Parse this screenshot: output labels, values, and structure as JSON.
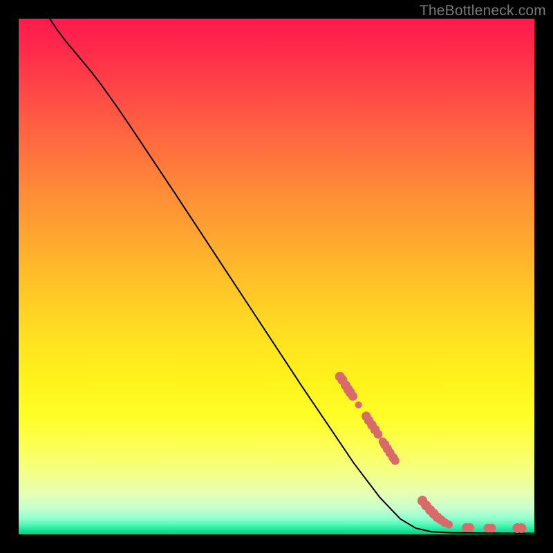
{
  "watermark": "TheBottleneck.com",
  "colors": {
    "frame": "#000000",
    "curve": "#000000",
    "marker_fill": "#d96a6a",
    "marker_stroke": "#a84a4a"
  },
  "chart_data": {
    "type": "line",
    "title": "",
    "xlabel": "",
    "ylabel": "",
    "xlim": [
      0,
      100
    ],
    "ylim": [
      0,
      100
    ],
    "grid": false,
    "legend": false,
    "curve": [
      {
        "x": 6.0,
        "y": 100.0
      },
      {
        "x": 7.5,
        "y": 97.8
      },
      {
        "x": 9.0,
        "y": 95.8
      },
      {
        "x": 10.5,
        "y": 94.0
      },
      {
        "x": 12.0,
        "y": 92.2
      },
      {
        "x": 14.0,
        "y": 89.8
      },
      {
        "x": 16.0,
        "y": 87.2
      },
      {
        "x": 19.0,
        "y": 83.0
      },
      {
        "x": 22.0,
        "y": 78.6
      },
      {
        "x": 26.0,
        "y": 72.6
      },
      {
        "x": 30.0,
        "y": 66.6
      },
      {
        "x": 35.0,
        "y": 59.0
      },
      {
        "x": 40.0,
        "y": 51.4
      },
      {
        "x": 45.0,
        "y": 43.8
      },
      {
        "x": 50.0,
        "y": 36.2
      },
      {
        "x": 55.0,
        "y": 28.6
      },
      {
        "x": 60.0,
        "y": 21.2
      },
      {
        "x": 65.0,
        "y": 13.8
      },
      {
        "x": 70.0,
        "y": 7.2
      },
      {
        "x": 74.0,
        "y": 3.0
      },
      {
        "x": 77.0,
        "y": 1.2
      },
      {
        "x": 80.0,
        "y": 0.5
      },
      {
        "x": 84.0,
        "y": 0.3
      },
      {
        "x": 90.0,
        "y": 0.25
      },
      {
        "x": 96.0,
        "y": 0.2
      },
      {
        "x": 100.0,
        "y": 0.2
      }
    ],
    "markers": [
      {
        "x": 62.3,
        "y": 30.6,
        "r": 7.0
      },
      {
        "x": 62.8,
        "y": 29.9,
        "r": 7.0
      },
      {
        "x": 63.4,
        "y": 28.9,
        "r": 7.0
      },
      {
        "x": 63.9,
        "y": 28.1,
        "r": 7.0
      },
      {
        "x": 64.3,
        "y": 27.5,
        "r": 7.0
      },
      {
        "x": 64.8,
        "y": 26.8,
        "r": 6.6
      },
      {
        "x": 65.9,
        "y": 25.1,
        "r": 5.0
      },
      {
        "x": 67.4,
        "y": 22.9,
        "r": 6.8
      },
      {
        "x": 67.9,
        "y": 22.1,
        "r": 6.8
      },
      {
        "x": 68.5,
        "y": 21.2,
        "r": 6.8
      },
      {
        "x": 69.1,
        "y": 20.3,
        "r": 6.8
      },
      {
        "x": 69.7,
        "y": 19.4,
        "r": 6.4
      },
      {
        "x": 70.6,
        "y": 18.0,
        "r": 6.0
      },
      {
        "x": 71.0,
        "y": 17.4,
        "r": 6.6
      },
      {
        "x": 71.5,
        "y": 16.6,
        "r": 6.6
      },
      {
        "x": 72.0,
        "y": 15.8,
        "r": 6.6
      },
      {
        "x": 72.6,
        "y": 14.9,
        "r": 6.6
      },
      {
        "x": 73.0,
        "y": 14.3,
        "r": 6.2
      },
      {
        "x": 78.3,
        "y": 6.5,
        "r": 7.2
      },
      {
        "x": 79.0,
        "y": 5.6,
        "r": 7.2
      },
      {
        "x": 79.8,
        "y": 4.7,
        "r": 7.2
      },
      {
        "x": 80.5,
        "y": 4.0,
        "r": 7.2
      },
      {
        "x": 81.2,
        "y": 3.3,
        "r": 7.0
      },
      {
        "x": 81.9,
        "y": 2.8,
        "r": 6.6
      },
      {
        "x": 82.6,
        "y": 2.3,
        "r": 6.2
      },
      {
        "x": 83.4,
        "y": 1.9,
        "r": 5.8
      },
      {
        "x": 86.8,
        "y": 1.3,
        "r": 6.4
      },
      {
        "x": 87.5,
        "y": 1.3,
        "r": 6.4
      },
      {
        "x": 91.0,
        "y": 1.2,
        "r": 6.4
      },
      {
        "x": 91.7,
        "y": 1.2,
        "r": 6.4
      },
      {
        "x": 96.7,
        "y": 1.2,
        "r": 7.0
      },
      {
        "x": 97.5,
        "y": 1.2,
        "r": 7.0
      }
    ]
  }
}
